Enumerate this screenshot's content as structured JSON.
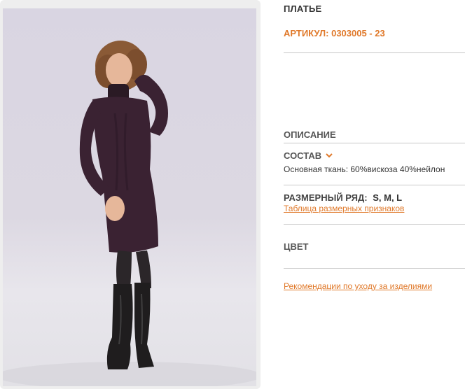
{
  "product": {
    "title": "ПЛАТЬЕ",
    "article": "АРТИКУЛ: 0303005 - 23"
  },
  "sections": {
    "description_label": "ОПИСАНИЕ",
    "composition_label": "СОСТАВ",
    "composition_text": "Основная ткань: 60%вискоза 40%нейлон",
    "size_label": "РАЗМЕРНЫЙ РЯД:",
    "size_values": "S, M, L",
    "size_table_link": "Таблица размерных признаков",
    "color_label": "ЦВЕТ",
    "care_link": "Рекомендации по уходу за изделиями"
  },
  "icons": {
    "composition_toggle": "chevron-down-icon"
  },
  "colors": {
    "accent": "#e0792a",
    "dress": "#3a2232",
    "boots": "#1f1d1e"
  }
}
